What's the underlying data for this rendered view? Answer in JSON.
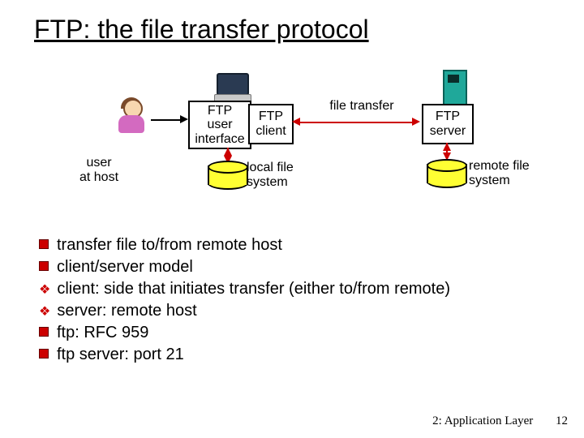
{
  "title": "FTP: the file transfer protocol",
  "diagram": {
    "user_at_host": "user\nat host",
    "ftp_ui": "FTP\nuser\ninterface",
    "ftp_client": "FTP\nclient",
    "file_transfer": "file transfer",
    "ftp_server": "FTP\nserver",
    "local_fs": "local file\nsystem",
    "remote_fs": "remote file\nsystem"
  },
  "bullets": {
    "b1": "transfer file to/from remote host",
    "b2": "client/server model",
    "b2a_prefix": "client:",
    "b2a_rest": " side that initiates transfer (either to/from remote)",
    "b2b_prefix": "server:",
    "b2b_rest": " remote host",
    "b3": "ftp: RFC 959",
    "b4": "ftp server: port 21"
  },
  "footer": {
    "chapter": "2: Application Layer",
    "page": "12"
  }
}
